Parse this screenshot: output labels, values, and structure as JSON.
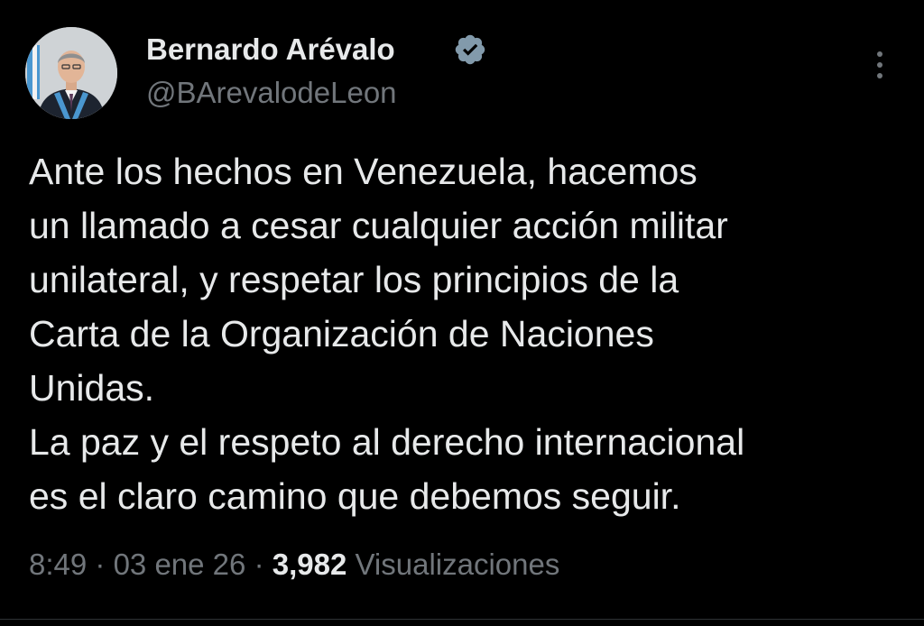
{
  "author": {
    "name": "Bernardo Arévalo",
    "handle": "@BArevalodeLeon",
    "verified": true,
    "avatar_icon": "profile-photo"
  },
  "tweet": {
    "lines": [
      "Ante los hechos en Venezuela, hacemos",
      "un llamado a cesar cualquier acción militar",
      "unilateral, y respetar los principios de la",
      "Carta de la Organización de Naciones",
      "Unidas.",
      "La paz y el respeto al derecho internacional",
      "es el claro camino que debemos seguir."
    ]
  },
  "meta": {
    "time": "8:49",
    "separator": "·",
    "date": "03 ene 26",
    "views_count": "3,982",
    "views_label": "Visualizaciones"
  },
  "icons": {
    "verified": "verified-badge-icon",
    "more": "more-vertical-icon"
  },
  "colors": {
    "background": "#000000",
    "text_primary": "#e7e9ea",
    "text_secondary": "#71767b",
    "verified_badge": "#829aab"
  }
}
